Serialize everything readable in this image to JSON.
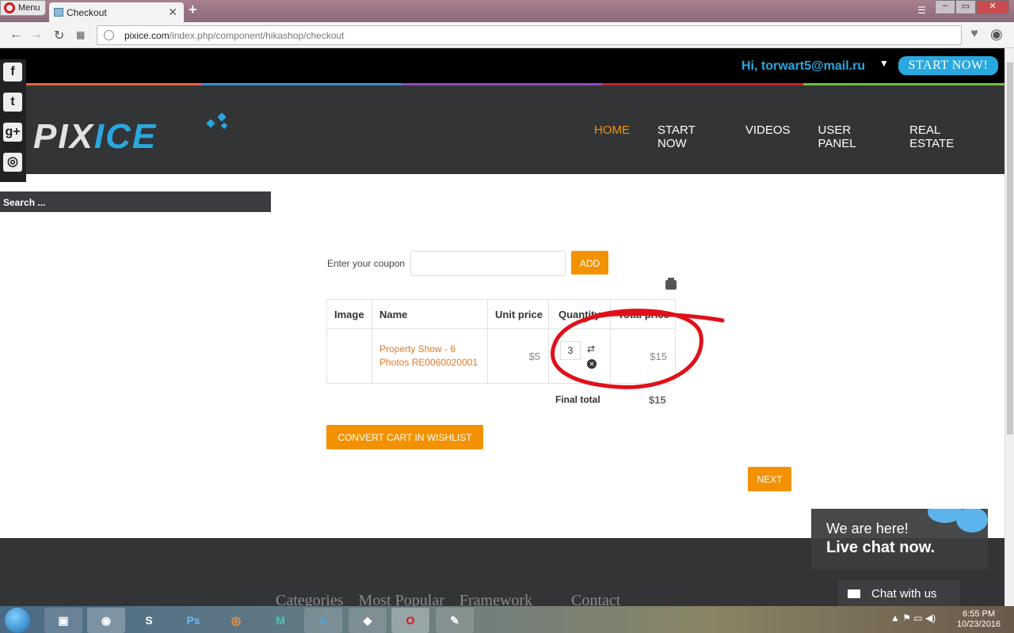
{
  "browser": {
    "menu_label": "Menu",
    "tab_title": "Checkout",
    "url_host": "pixice.com",
    "url_path": "/index.php/component/hikashop/checkout"
  },
  "topbar": {
    "greeting": "Hi, torwart5@mail.ru",
    "start_now": "START NOW!"
  },
  "header": {
    "logo_left": "PIX",
    "logo_right": "ICE",
    "nav": [
      "HOME",
      "START NOW",
      "VIDEOS",
      "USER PANEL",
      "REAL ESTATE"
    ],
    "active_nav": "HOME"
  },
  "sidebar": {
    "search_placeholder": "Search ..."
  },
  "coupon": {
    "label": "Enter your coupon",
    "add_label": "ADD"
  },
  "cart": {
    "headers": [
      "Image",
      "Name",
      "Unit price",
      "Quantity",
      "Total price"
    ],
    "rows": [
      {
        "name_line1": "Property Show - 6",
        "name_line2": "Photos RE0060020001",
        "unit_price": "$5",
        "quantity": "3",
        "total_price": "$15"
      }
    ],
    "final_total_label": "Final total",
    "final_total_value": "$15"
  },
  "buttons": {
    "wishlist": "CONVERT CART IN WISHLIST",
    "next": "NEXT"
  },
  "footer": {
    "links": [
      "Categories",
      "Most Popular",
      "Framework",
      "Contact"
    ]
  },
  "chat": {
    "line1": "We are here!",
    "line2": "Live chat now.",
    "button": "Chat with us"
  },
  "taskbar": {
    "time": "6:55 PM",
    "date": "10/23/2016"
  },
  "colors": {
    "accent_orange": "#f39200",
    "accent_blue": "#29a8e0",
    "header_bg": "#333436",
    "annotation_red": "#e0101a"
  }
}
